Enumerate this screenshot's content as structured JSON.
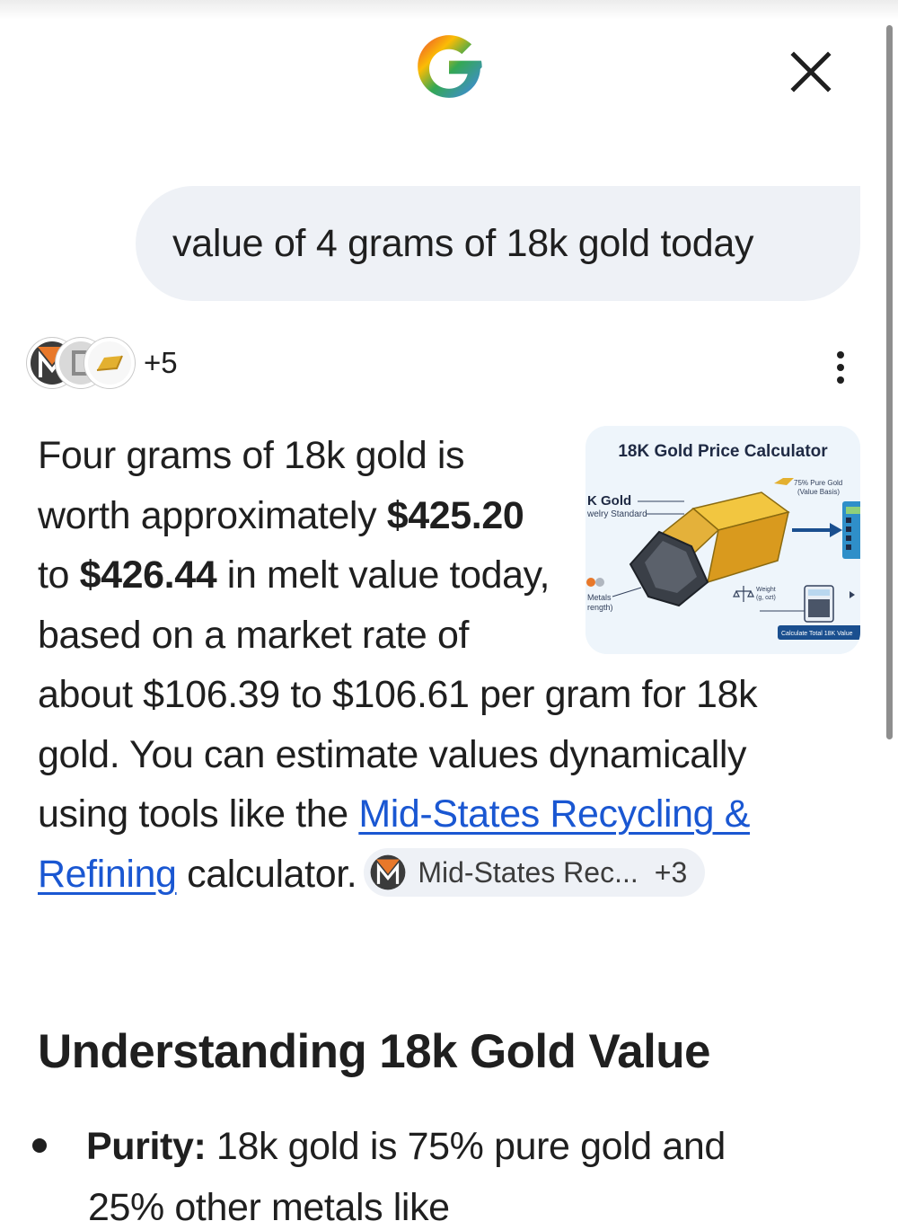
{
  "query": "value of 4 grams of 18k gold today",
  "sources": {
    "count_label": "+5"
  },
  "answer": {
    "p1": "Four grams of 18k gold is worth approximately ",
    "low": "$425.20",
    "to": " to ",
    "high": "$426.44",
    "p2": " in melt value today, based on a market rate of about $106.39 to $106.61 per gram for 18k gold. You can estimate values dynamically using tools like the ",
    "link": "Mid-States Recycling & Refining",
    "p3": " calculator."
  },
  "citation_chip": {
    "label": "Mid-States Rec...",
    "more": "+3"
  },
  "thumbnail": {
    "title": "18K Gold Price Calculator",
    "label_gold": "K Gold",
    "label_standard": "welry Standard",
    "label_pure1": "75% Pure Gold",
    "label_pure2": "(Value Basis)",
    "label_metals1": "Metals",
    "label_metals2": "rength)",
    "label_weight1": "Weight",
    "label_weight2": "(g, ozt)",
    "button": "Calculate Total 18K Value"
  },
  "section_heading": "Understanding 18k Gold Value",
  "bullet": {
    "term": "Purity:",
    "text": " 18k gold is 75% pure gold and"
  },
  "cut_line": "25% other metals like",
  "colors": {
    "link": "#1a57d2",
    "bubble": "#eef1f6",
    "gold": "#e3b030"
  },
  "icons": [
    "google-g-icon",
    "close-icon",
    "more-vert-icon"
  ]
}
